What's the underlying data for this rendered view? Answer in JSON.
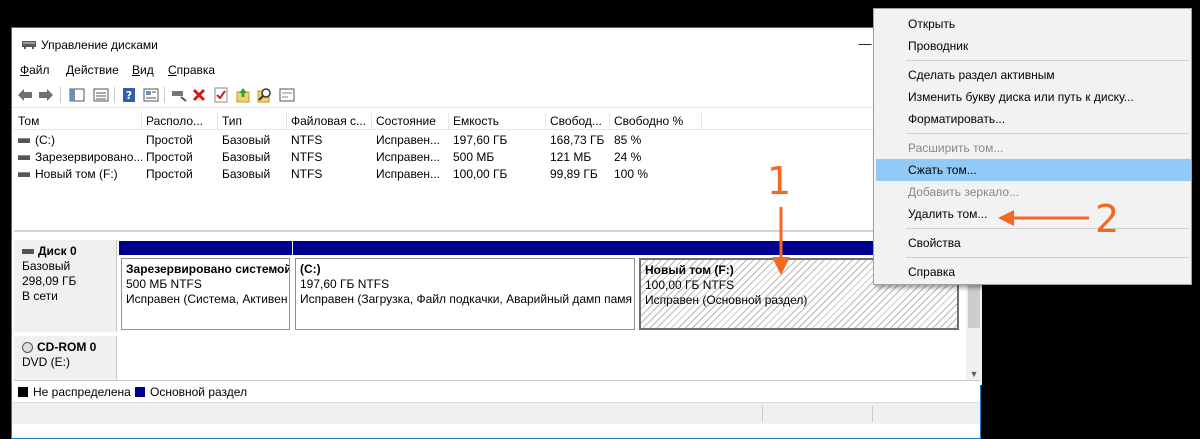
{
  "window": {
    "title": "Управление дисками",
    "controls": {
      "minimize": "—"
    }
  },
  "menu": [
    {
      "label": "Файл",
      "accel": "Ф",
      "rest": "айл"
    },
    {
      "label": "Действие",
      "accel": "Д",
      "rest": "ействие"
    },
    {
      "label": "Вид",
      "accel": "В",
      "rest": "ид"
    },
    {
      "label": "Справка",
      "accel": "С",
      "rest": "правка"
    }
  ],
  "toolbar": {
    "icons": [
      "back-icon",
      "forward-icon",
      "show-hide-tree-icon",
      "list-view-icon",
      "help-icon",
      "properties-icon",
      "connect-icon",
      "delete-icon",
      "check-icon",
      "up-icon",
      "search-icon",
      "settings-icon"
    ],
    "help_glyph": "?"
  },
  "volumes_table": {
    "columns": [
      "Том",
      "Располо...",
      "Тип",
      "Файловая с...",
      "Состояние",
      "Емкость",
      "Свобод...",
      "Свободно %"
    ],
    "rows": [
      {
        "name": "(C:)",
        "layout": "Простой",
        "type": "Базовый",
        "fs": "NTFS",
        "status": "Исправен...",
        "capacity": "197,60 ГБ",
        "free": "168,73 ГБ",
        "free_pct": "85 %"
      },
      {
        "name": "Зарезервировано...",
        "layout": "Простой",
        "type": "Базовый",
        "fs": "NTFS",
        "status": "Исправен...",
        "capacity": "500 МБ",
        "free": "121 МБ",
        "free_pct": "24 %"
      },
      {
        "name": "Новый том (F:)",
        "layout": "Простой",
        "type": "Базовый",
        "fs": "NTFS",
        "status": "Исправен...",
        "capacity": "100,00 ГБ",
        "free": "99,89 ГБ",
        "free_pct": "100 %"
      }
    ]
  },
  "disks": [
    {
      "name": "Диск 0",
      "type": "Базовый",
      "size": "298,09 ГБ",
      "status": "В сети",
      "partitions": [
        {
          "title": "Зарезервировано системой",
          "size": "500 МБ NTFS",
          "status": "Исправен (Система, Активен"
        },
        {
          "title": "(C:)",
          "size": "197,60 ГБ NTFS",
          "status": "Исправен (Загрузка, Файл подкачки, Аварийный дамп памя"
        },
        {
          "title": "Новый том  (F:)",
          "size": "100,00 ГБ NTFS",
          "status": "Исправен (Основной раздел)"
        }
      ]
    },
    {
      "name": "CD-ROM 0",
      "type": "DVD (E:)"
    }
  ],
  "legend": [
    {
      "label": "Не распределена",
      "color": "#000000"
    },
    {
      "label": "Основной раздел",
      "color": "#00008e"
    }
  ],
  "context_menu": [
    {
      "label": "Открыть",
      "enabled": true
    },
    {
      "label": "Проводник",
      "enabled": true
    },
    {
      "label": "Сделать раздел активным",
      "enabled": true
    },
    {
      "label": "Изменить букву диска или путь к диску...",
      "enabled": true
    },
    {
      "label": "Форматировать...",
      "enabled": true
    },
    {
      "label": "Расширить том...",
      "enabled": false
    },
    {
      "label": "Сжать том...",
      "enabled": true,
      "highlighted": true
    },
    {
      "label": "Добавить зеркало...",
      "enabled": false
    },
    {
      "label": "Удалить том...",
      "enabled": true
    },
    {
      "label": "Свойства",
      "enabled": true
    },
    {
      "label": "Справка",
      "enabled": true
    }
  ],
  "annotations": [
    {
      "label": "1",
      "color": "#f26a21"
    },
    {
      "label": "2",
      "color": "#f26a21"
    }
  ]
}
